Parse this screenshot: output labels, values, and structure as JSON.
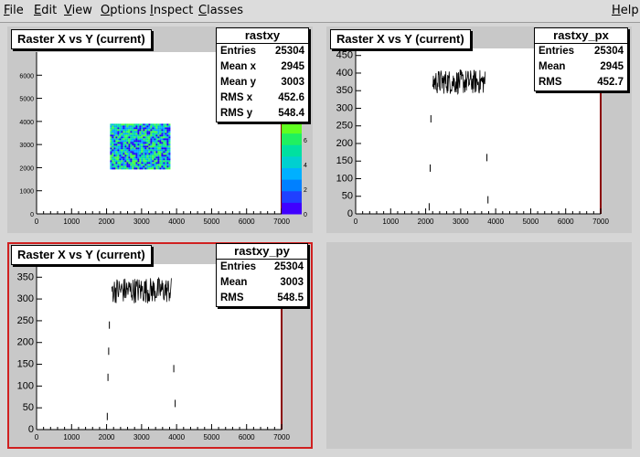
{
  "menu": [
    {
      "name": "menu-file",
      "label": "File",
      "ul": "F",
      "rest": "ile"
    },
    {
      "name": "menu-edit",
      "label": "Edit",
      "ul": "E",
      "rest": "dit"
    },
    {
      "name": "menu-view",
      "label": "View",
      "ul": "V",
      "rest": "iew"
    },
    {
      "name": "menu-options",
      "label": "Options",
      "ul": "O",
      "rest": "ptions"
    },
    {
      "name": "menu-inspect",
      "label": "Inspect",
      "ul": "I",
      "rest": "nspect"
    },
    {
      "name": "menu-classes",
      "label": "Classes",
      "ul": "C",
      "rest": "lasses"
    },
    {
      "name": "menu-help",
      "label": "Help",
      "ul": "H",
      "rest": "elp"
    }
  ],
  "pads": {
    "pad1": {
      "title": "Raster X vs Y (current)",
      "stats": {
        "name": "rastxy",
        "rows": [
          [
            "Entries",
            "25304"
          ],
          [
            "Mean x",
            "2945"
          ],
          [
            "Mean y",
            "3003"
          ],
          [
            "RMS x",
            "452.6"
          ],
          [
            "RMS y",
            "548.4"
          ]
        ]
      }
    },
    "pad2": {
      "title": "Raster X vs Y (current)",
      "stats": {
        "name": "rastxy_px",
        "rows": [
          [
            "Entries",
            "25304"
          ],
          [
            "Mean",
            "2945"
          ],
          [
            "RMS",
            "452.7"
          ]
        ]
      }
    },
    "pad3": {
      "title": "Raster X vs Y (current)",
      "stats": {
        "name": "rastxy_py",
        "rows": [
          [
            "Entries",
            "25304"
          ],
          [
            "Mean",
            "3003"
          ],
          [
            "RMS",
            "548.5"
          ]
        ]
      }
    }
  },
  "chart_data": [
    {
      "type": "heatmap",
      "name": "rastxy",
      "x_ticks": [
        "0",
        "1000",
        "2000",
        "3000",
        "4000",
        "5000",
        "6000",
        "7000"
      ],
      "y_ticks": [
        "0",
        "1000",
        "2000",
        "3000",
        "4000",
        "5000",
        "6000"
      ],
      "xlim": [
        0,
        7000
      ],
      "ylim": [
        0,
        7000
      ],
      "filled_region": {
        "x": [
          2100,
          3800
        ],
        "y": [
          2000,
          3900
        ]
      },
      "palette_ticks": [
        "0",
        "2",
        "4",
        "6"
      ],
      "colors": [
        "#1a00ff",
        "#00a0ff",
        "#00e0a0",
        "#40ff40"
      ]
    },
    {
      "type": "line",
      "name": "rastxy_px",
      "x_ticks": [
        "0",
        "1000",
        "2000",
        "3000",
        "4000",
        "5000",
        "6000",
        "7000"
      ],
      "y_ticks": [
        "0",
        "50",
        "100",
        "150",
        "200",
        "250",
        "300",
        "350",
        "400",
        "450"
      ],
      "xlim": [
        0,
        7000
      ],
      "ylim": [
        0,
        470
      ],
      "plateau": {
        "from": 2200,
        "to": 3700,
        "level": 375,
        "spread": 35
      },
      "edges": [
        [
          2100,
          20
        ],
        [
          2130,
          130
        ],
        [
          2150,
          270
        ],
        [
          3750,
          160
        ],
        [
          3780,
          40
        ]
      ]
    },
    {
      "type": "line",
      "name": "rastxy_py",
      "x_ticks": [
        "0",
        "1000",
        "2000",
        "3000",
        "4000",
        "5000",
        "6000",
        "7000"
      ],
      "y_ticks": [
        "0",
        "50",
        "100",
        "150",
        "200",
        "250",
        "300",
        "350"
      ],
      "xlim": [
        0,
        7000
      ],
      "ylim": [
        0,
        380
      ],
      "plateau": {
        "from": 2150,
        "to": 3850,
        "level": 320,
        "spread": 30
      },
      "edges": [
        [
          2020,
          30
        ],
        [
          2040,
          120
        ],
        [
          2060,
          180
        ],
        [
          2080,
          240
        ],
        [
          3920,
          140
        ],
        [
          3960,
          60
        ]
      ]
    }
  ]
}
